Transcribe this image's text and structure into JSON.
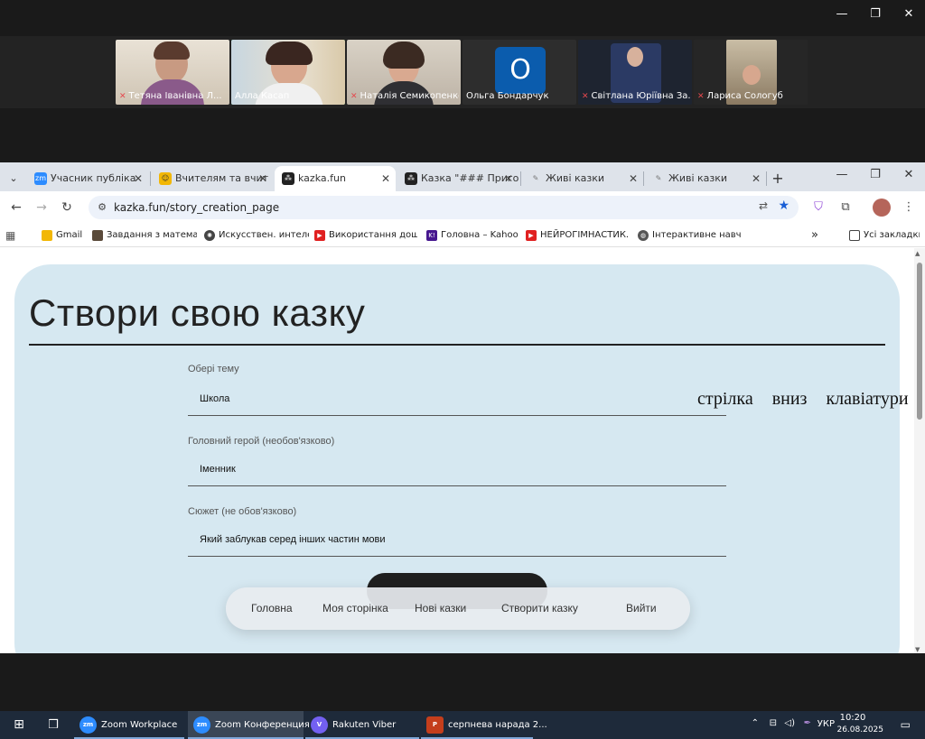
{
  "zoom": {
    "participants": [
      {
        "name": "Тетяна Іванівна Л...",
        "muted": true,
        "active": false
      },
      {
        "name": "Алла Касап",
        "muted": false,
        "active": true
      },
      {
        "name": "Наталія Семикопенко",
        "muted": true,
        "active": false
      },
      {
        "name": "Ольга Бондарчук",
        "muted": false,
        "active": false,
        "avatar_letter": "О"
      },
      {
        "name": "Світлана Юріївна За...",
        "muted": true,
        "active": false
      },
      {
        "name": "Лариса Сологуб",
        "muted": true,
        "active": false
      }
    ],
    "window_controls": {
      "minimize": "—",
      "restore": "❐",
      "close": "✕"
    }
  },
  "browser": {
    "tabs": [
      {
        "title": "Учасник публіка",
        "icon": "zoom-icon"
      },
      {
        "title": "Вчителям та вчит",
        "icon": "school-icon"
      },
      {
        "title": "kazka.fun",
        "icon": "kazka-icon",
        "active": true
      },
      {
        "title": "Казка \"### Приго",
        "icon": "kazka-icon"
      },
      {
        "title": "Живі казки",
        "icon": "magic-icon"
      },
      {
        "title": "Живі казки",
        "icon": "magic-icon"
      }
    ],
    "url": "kazka.fun/story_creation_page",
    "bookmarks": [
      {
        "label": "Gmail",
        "color": "#f2b705"
      },
      {
        "label": "Завдання з матема...",
        "color": "#5a4a3a"
      },
      {
        "label": "Искусствен. интеле...",
        "color": "#444"
      },
      {
        "label": "Використання дош...",
        "color": "#e02020"
      },
      {
        "label": "Головна – Kahoot!",
        "color": "#46178f"
      },
      {
        "label": "НЕЙРОГІМНАСТИК...",
        "color": "#e02020"
      },
      {
        "label": "Інтерактивне навч...",
        "color": "#555"
      }
    ],
    "all_bookmarks": "Усі закладки"
  },
  "page": {
    "title": "Створи свою казку",
    "fields": {
      "topic": {
        "label": "Обері тему",
        "value": "Школа"
      },
      "hero": {
        "label": "Головний герой (необов'язково)",
        "value": "Іменник"
      },
      "plot": {
        "label": "Сюжет (не обов'язково)",
        "value": "Який заблукав серед інших частин мови"
      }
    },
    "annotation": "стрілка вниз клавіатури",
    "nav": {
      "home": "Головна",
      "my_page": "Моя сторінка",
      "new_tales": "Нові казки",
      "create": "Створити казку",
      "logout": "Вийти"
    }
  },
  "taskbar": {
    "items": [
      {
        "label": "Zoom Workplace",
        "color": "#2d8cff",
        "badge": "zm"
      },
      {
        "label": "Zoom Конференция",
        "color": "#2d8cff",
        "badge": "zm",
        "active": true
      },
      {
        "label": "Rakuten Viber",
        "color": "#7360f2",
        "badge": "V"
      },
      {
        "label": "серпнева нарада 2...",
        "color": "#c43e1c",
        "badge": "P"
      }
    ],
    "lang": "УКР",
    "time": "10:20",
    "date": "26.08.2025"
  }
}
